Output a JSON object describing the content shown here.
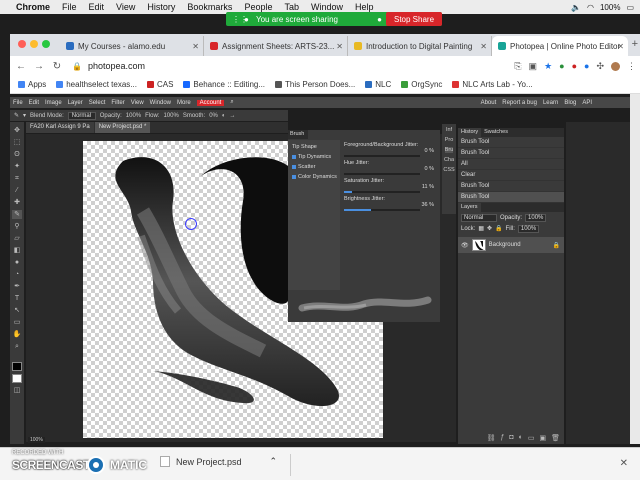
{
  "mac_menubar": {
    "app": "Chrome",
    "items": [
      "File",
      "Edit",
      "View",
      "History",
      "Bookmarks",
      "People",
      "Tab",
      "Window",
      "Help"
    ],
    "battery": "100%",
    "sound_icon": "speaker-icon",
    "wifi_icon": "wifi-icon"
  },
  "share_banner": {
    "text": "You are screen sharing",
    "stop_label": "Stop Share",
    "accent": "#1faa3a",
    "stop_color": "#d8262a"
  },
  "tabs": [
    {
      "label": "My Courses - alamo.edu",
      "fav_color": "#2a6cbf"
    },
    {
      "label": "Assignment Sheets: ARTS-23...",
      "fav_color": "#d8262a"
    },
    {
      "label": "Introduction to Digital Painting",
      "fav_color": "#e8b923"
    },
    {
      "label": "Photopea | Online Photo Editor",
      "fav_color": "#18a497"
    }
  ],
  "address": {
    "url": "photopea.com"
  },
  "bookmarks": [
    {
      "label": "Apps",
      "color": "#4285f4"
    },
    {
      "label": "healthselect texas...",
      "color": "#4285f4"
    },
    {
      "label": "CAS",
      "color": "#c22"
    },
    {
      "label": "Behance :: Editing...",
      "color": "#1769ff"
    },
    {
      "label": "This Person Does...",
      "color": "#555"
    },
    {
      "label": "NLC",
      "color": "#2a6cbf"
    },
    {
      "label": "OrgSync",
      "color": "#3a9d3a"
    },
    {
      "label": "NLC Arts Lab - Yo...",
      "color": "#d33"
    }
  ],
  "pp_menu": {
    "items": [
      "File",
      "Edit",
      "Image",
      "Layer",
      "Select",
      "Filter",
      "View",
      "Window",
      "More"
    ],
    "account": "Account",
    "right": [
      "About",
      "Report a bug",
      "Learn",
      "Blog",
      "API"
    ]
  },
  "pp_options": {
    "blend_label": "Blend Mode:",
    "blend_value": "Normal",
    "opacity_label": "Opacity:",
    "opacity_value": "100%",
    "flow_label": "Flow:",
    "flow_value": "100%",
    "smooth_label": "Smooth:",
    "smooth_value": "0%"
  },
  "doc_tabs": [
    {
      "label": "FA20 Karl Assign 9 Pa"
    },
    {
      "label": "New Project.psd *"
    }
  ],
  "zoom": "100%",
  "brush_panel": {
    "tab": "Brush",
    "left_items": [
      {
        "label": "Tip Shape",
        "checked": false
      },
      {
        "label": "Tip Dynamics",
        "checked": true
      },
      {
        "label": "Scatter",
        "checked": true
      },
      {
        "label": "Color Dynamics",
        "checked": true
      }
    ],
    "sliders": [
      {
        "label": "Foreground/Background Jitter:",
        "value": "0 %",
        "fraction": 0.0
      },
      {
        "label": "Hue Jitter:",
        "value": "0 %",
        "fraction": 0.0
      },
      {
        "label": "Saturation Jitter:",
        "value": "11 %",
        "fraction": 0.11
      },
      {
        "label": "Brightness Jitter:",
        "value": "36 %",
        "fraction": 0.36
      }
    ]
  },
  "side_icons": [
    "Inf",
    "Pro",
    "Bru",
    "Cha",
    "CSS"
  ],
  "history": {
    "tabs": [
      "History",
      "Swatches"
    ],
    "items": [
      "Brush Tool",
      "Brush Tool",
      "All",
      "Clear",
      "Brush Tool",
      "Brush Tool"
    ]
  },
  "layers": {
    "tab": "Layers",
    "blend": "Normal",
    "opacity_label": "Opacity:",
    "opacity": "100%",
    "lock_label": "Lock:",
    "fill_label": "Fill:",
    "fill": "100%",
    "layer_name": "Background"
  },
  "screencast": {
    "recorded": "RECORDED WITH",
    "brand_left": "SCREENCAST",
    "brand_right": "MATIC"
  },
  "download": {
    "filename": "New Project.psd",
    "chevron_icon": "chevron-up-icon"
  }
}
